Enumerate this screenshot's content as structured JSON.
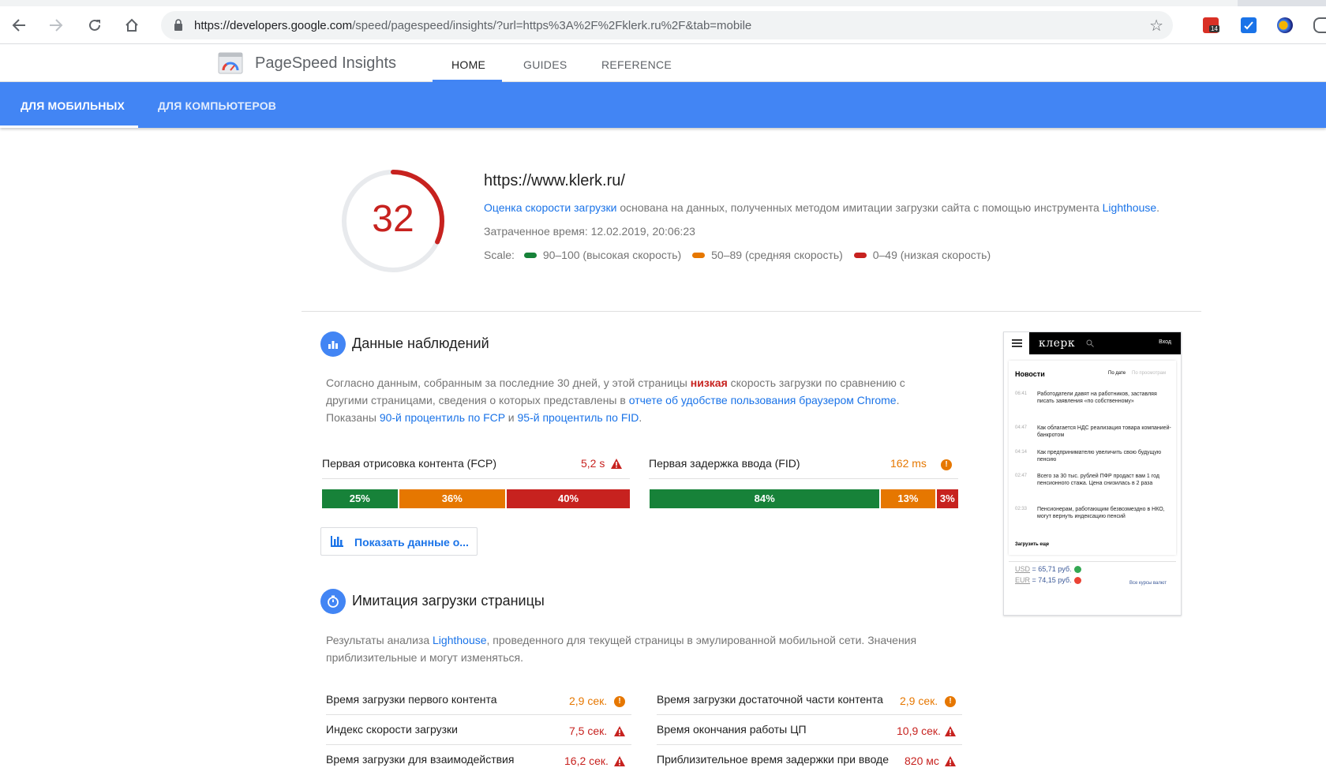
{
  "browser": {
    "url_host": "https://developers.google.com",
    "url_path": "/speed/pagespeed/insights/?url=https%3A%2F%2Fklerk.ru%2F&tab=mobile",
    "ext_badge": "14"
  },
  "header": {
    "title": "PageSpeed Insights",
    "tabs": [
      "HOME",
      "GUIDES",
      "REFERENCE"
    ]
  },
  "device_tabs": [
    "ДЛЯ МОБИЛЬНЫХ",
    "ДЛЯ КОМПЬЮТЕРОВ"
  ],
  "summary": {
    "score": "32",
    "score_fraction": 0.32,
    "site": "https://www.klerk.ru/",
    "desc_link": "Оценка скорости загрузки",
    "desc_text": " основана на данных, полученных методом имитации загрузки сайта с помощью инструмента ",
    "desc_link2": "Lighthouse",
    "desc_end": ".",
    "time": "Затраченное время: 12.02.2019, 20:06:23",
    "scale_label": "Scale:",
    "scale_fast": "90–100 (высокая скорость)",
    "scale_avg": "50–89 (средняя скорость)",
    "scale_slow": "0–49 (низкая скорость)",
    "colors": {
      "fast": "#178239",
      "average": "#e67700",
      "slow": "#c7221f"
    }
  },
  "field": {
    "title": "Данные наблюдений",
    "p1": "Согласно данным, собранным за последние 30 дней, у этой страницы ",
    "p1_bad": "низкая",
    "p1_end": " скорость загрузки по сравнению с",
    "p2": "другими страницами, сведения о которых представлены в ",
    "p2_link": "отчете об удобстве пользования браузером Chrome",
    "p2_end": ".",
    "p3": "Показаны ",
    "p3_link1": "90-й процентиль по FCP",
    "p3_mid": " и ",
    "p3_link2": "95-й процентиль по FID",
    "p3_end": ".",
    "fcp": {
      "label": "Первая отрисовка контента (FCP)",
      "value": "5,2 s",
      "dist": [
        "25%",
        "36%",
        "40%"
      ]
    },
    "fid": {
      "label": "Первая задержка ввода (FID)",
      "value": "162 ms",
      "dist": [
        "84%",
        "13%",
        "3%"
      ]
    },
    "origin_button": "Показать данные о..."
  },
  "lab": {
    "title": "Имитация загрузки страницы",
    "p1_start": "Результаты анализа ",
    "p1_link": "Lighthouse",
    "p1_end": ", проведенного для текущей страницы в эмулированной мобильной сети. Значения",
    "p2": "приблизительные и могут изменяться.",
    "metrics": [
      {
        "label": "Время загрузки первого контента",
        "value": "2,9 сек."
      },
      {
        "label": "Время загрузки достаточной части контента",
        "value": "2,9 сек."
      },
      {
        "label": "Индекс скорости загрузки",
        "value": "7,5 сек."
      },
      {
        "label": "Время окончания работы ЦП",
        "value": "10,9 сек."
      },
      {
        "label": "Время загрузки для взаимодействия",
        "value": "16,2 сек."
      },
      {
        "label": "Приблизительное время задержки при вводе",
        "value": "820 мс"
      }
    ]
  },
  "phone": {
    "logo": "клерк",
    "login": "Вход",
    "news_title": "Новости",
    "sort_date": "По дате",
    "sort_views": "По просмотрам",
    "items": [
      {
        "time": "06:41",
        "text": "Работодатели давят на работников, заставляя писать заявления «по собственному»"
      },
      {
        "time": "04:47",
        "text": "Как облагается НДС реализация товара компанией-банкротом"
      },
      {
        "time": "04:14",
        "text": "Как предпринимателю увеличить свою будущую пенсию"
      },
      {
        "time": "02:47",
        "text": "Всего за 30 тыс. рублей ПФР продаст вам 1 год пенсионного стажа. Цена снизилась в 2 раза"
      },
      {
        "time": "02:33",
        "text": "Пенсионерам, работающим безвозмездно в НКО, могут вернуть индексацию пенсий"
      }
    ],
    "more": "Загрузить еще",
    "usd_label": "USD",
    "usd_value": "= 65,71 руб.",
    "eur_label": "EUR",
    "eur_value": "= 74,15 руб.",
    "all_rates": "Все курсы валют"
  }
}
